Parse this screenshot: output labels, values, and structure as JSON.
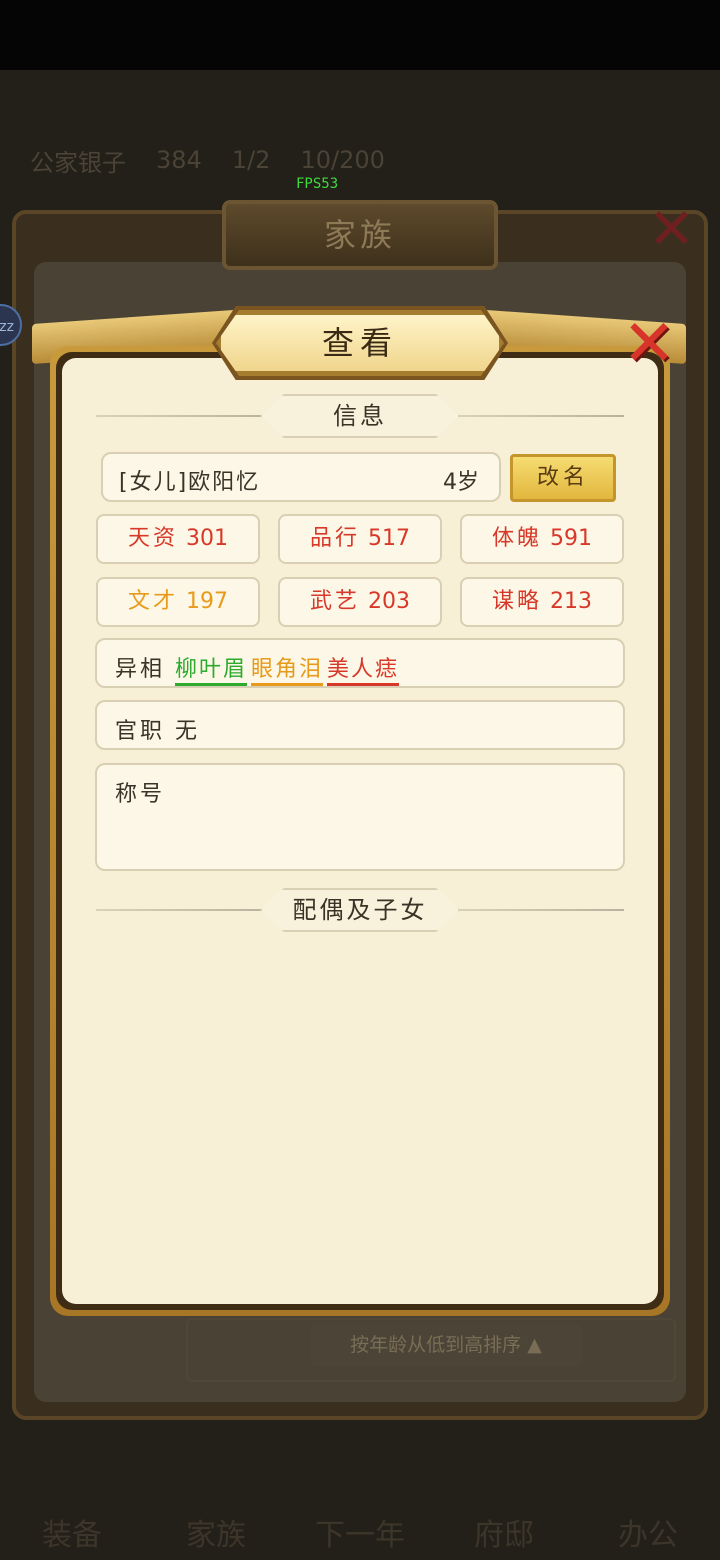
{
  "fps": "FPS53",
  "background": {
    "family_title": "家族",
    "sort_label": "按年龄从低到高排序",
    "resource_bar": [
      "公家银子",
      "384",
      "1/2",
      "10/200"
    ],
    "left_badge": "zz",
    "nav": [
      "装备",
      "家族",
      "下一年",
      "府邸",
      "办公"
    ]
  },
  "dialog": {
    "title": "查看",
    "info_header": "信息",
    "person_name": "[女儿]欧阳忆",
    "age": "4岁",
    "rename_label": "改名",
    "stats": [
      {
        "label": "天资",
        "value": "301",
        "color": "#d8382a"
      },
      {
        "label": "品行",
        "value": "517",
        "color": "#d8382a"
      },
      {
        "label": "体魄",
        "value": "591",
        "color": "#d8382a"
      },
      {
        "label": "文才",
        "value": "197",
        "color": "#e89a1a"
      },
      {
        "label": "武艺",
        "value": "203",
        "color": "#d8382a"
      },
      {
        "label": "谋略",
        "value": "213",
        "color": "#d8382a"
      }
    ],
    "appearance_label": "异相",
    "traits": [
      {
        "text": "柳叶眉",
        "color": "#2eaa2e"
      },
      {
        "text": "眼角泪",
        "color": "#e89a1a"
      },
      {
        "text": "美人痣",
        "color": "#d8382a"
      }
    ],
    "office_label": "官职",
    "office_value": "无",
    "title_label": "称号",
    "family_header": "配偶及子女"
  }
}
